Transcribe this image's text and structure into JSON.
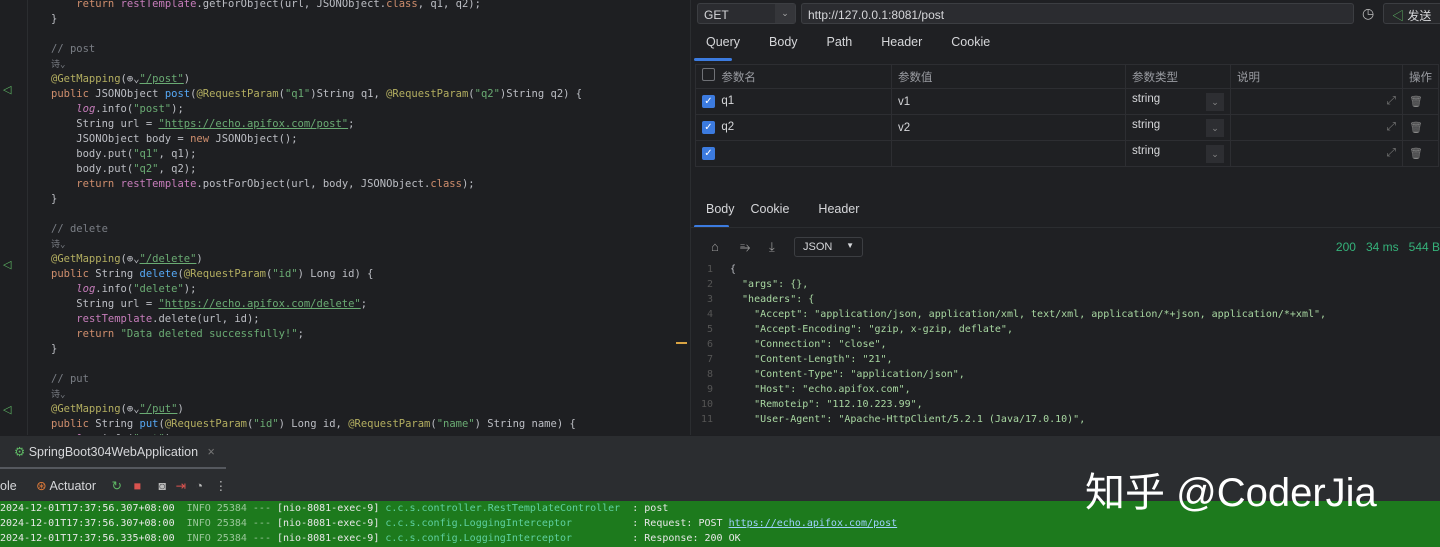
{
  "editor": {
    "lines": [
      [
        [
          "    ",
          ""
        ],
        [
          "return ",
          "kw"
        ],
        [
          "restTemplate",
          "fld"
        ],
        [
          ".getForObject(url, JSONObject.",
          ""
        ],
        [
          "class",
          "kw"
        ],
        [
          ", q1, q2);",
          ""
        ]
      ],
      [
        [
          "}",
          ""
        ]
      ],
      [],
      [
        [
          "// post",
          "cm"
        ]
      ],
      [
        [
          "诗⌄",
          "hint"
        ]
      ],
      [
        [
          "@GetMapping",
          "ann"
        ],
        [
          "(⊕⌄",
          ""
        ],
        [
          "\"/post\"",
          "url"
        ],
        [
          ")",
          ""
        ]
      ],
      [
        [
          "public ",
          "kw"
        ],
        [
          "JSONObject ",
          ""
        ],
        [
          "post",
          "fn"
        ],
        [
          "(",
          ""
        ],
        [
          "@RequestParam",
          "ann"
        ],
        [
          "(",
          ""
        ],
        [
          "\"q1\"",
          "str"
        ],
        [
          ")String q1, ",
          ""
        ],
        [
          "@RequestParam",
          "ann"
        ],
        [
          "(",
          ""
        ],
        [
          "\"q2\"",
          "str"
        ],
        [
          ")String q2) {",
          ""
        ]
      ],
      [
        [
          "    ",
          ""
        ],
        [
          "log",
          "it"
        ],
        [
          ".info(",
          ""
        ],
        [
          "\"post\"",
          "str"
        ],
        [
          ");",
          ""
        ]
      ],
      [
        [
          "    String url = ",
          ""
        ],
        [
          "\"https://echo.apifox.com/post\"",
          "url"
        ],
        [
          ";",
          ""
        ]
      ],
      [
        [
          "    JSONObject body = ",
          ""
        ],
        [
          "new ",
          "kw"
        ],
        [
          "JSONObject();",
          ""
        ]
      ],
      [
        [
          "    body.put(",
          ""
        ],
        [
          "\"q1\"",
          "str"
        ],
        [
          ", q1);",
          ""
        ]
      ],
      [
        [
          "    body.put(",
          ""
        ],
        [
          "\"q2\"",
          "str"
        ],
        [
          ", q2);",
          ""
        ]
      ],
      [
        [
          "    ",
          ""
        ],
        [
          "return ",
          "kw"
        ],
        [
          "restTemplate",
          "fld"
        ],
        [
          ".postForObject(url, body, JSONObject.",
          ""
        ],
        [
          "class",
          "kw"
        ],
        [
          ");",
          ""
        ]
      ],
      [
        [
          "}",
          ""
        ]
      ],
      [],
      [
        [
          "// delete",
          "cm"
        ]
      ],
      [
        [
          "诗⌄",
          "hint"
        ]
      ],
      [
        [
          "@GetMapping",
          "ann"
        ],
        [
          "(⊕⌄",
          ""
        ],
        [
          "\"/delete\"",
          "url"
        ],
        [
          ")",
          ""
        ]
      ],
      [
        [
          "public ",
          "kw"
        ],
        [
          "String ",
          ""
        ],
        [
          "delete",
          "fn"
        ],
        [
          "(",
          ""
        ],
        [
          "@RequestParam",
          "ann"
        ],
        [
          "(",
          ""
        ],
        [
          "\"id\"",
          "str"
        ],
        [
          ") Long id) {",
          ""
        ]
      ],
      [
        [
          "    ",
          ""
        ],
        [
          "log",
          "it"
        ],
        [
          ".info(",
          ""
        ],
        [
          "\"delete\"",
          "str"
        ],
        [
          ");",
          ""
        ]
      ],
      [
        [
          "    String url = ",
          ""
        ],
        [
          "\"https://echo.apifox.com/delete\"",
          "url"
        ],
        [
          ";",
          ""
        ]
      ],
      [
        [
          "    ",
          ""
        ],
        [
          "restTemplate",
          "fld"
        ],
        [
          ".delete(url, id);",
          ""
        ]
      ],
      [
        [
          "    ",
          ""
        ],
        [
          "return ",
          "kw"
        ],
        [
          "\"Data deleted successfully!\"",
          "str"
        ],
        [
          ";",
          ""
        ]
      ],
      [
        [
          "}",
          ""
        ]
      ],
      [],
      [
        [
          "// put",
          "cm"
        ]
      ],
      [
        [
          "诗⌄",
          "hint"
        ]
      ],
      [
        [
          "@GetMapping",
          "ann"
        ],
        [
          "(⊕⌄",
          ""
        ],
        [
          "\"/put\"",
          "url"
        ],
        [
          ")",
          ""
        ]
      ],
      [
        [
          "public ",
          "kw"
        ],
        [
          "String ",
          ""
        ],
        [
          "put",
          "fn"
        ],
        [
          "(",
          ""
        ],
        [
          "@RequestParam",
          "ann"
        ],
        [
          "(",
          ""
        ],
        [
          "\"id\"",
          "str"
        ],
        [
          ") Long id, ",
          ""
        ],
        [
          "@RequestParam",
          "ann"
        ],
        [
          "(",
          ""
        ],
        [
          "\"name\"",
          "str"
        ],
        [
          ") String name) {",
          ""
        ]
      ],
      [
        [
          "    ",
          ""
        ],
        [
          "log",
          "it"
        ],
        [
          ".info(",
          ""
        ],
        [
          "\"put\"",
          "str"
        ],
        [
          ");",
          ""
        ]
      ]
    ]
  },
  "request": {
    "method": "GET",
    "url": "http://127.0.0.1:8081/post",
    "send_label": "发送",
    "tabs": [
      "Query",
      "Body",
      "Path",
      "Header",
      "Cookie"
    ],
    "headers": [
      "参数名",
      "参数值",
      "参数类型",
      "说明",
      "操作"
    ],
    "params": [
      {
        "name": "q1",
        "value": "v1",
        "type": "string",
        "checked": true
      },
      {
        "name": "q2",
        "value": "v2",
        "type": "string",
        "checked": true
      },
      {
        "name": "",
        "value": "",
        "type": "string",
        "checked": true
      }
    ]
  },
  "response": {
    "tabs": [
      "Body",
      "Cookie",
      "Header"
    ],
    "format": "JSON",
    "status": "200",
    "time": "34 ms",
    "size": "544 B",
    "lines": [
      "{",
      "  \"args\": {},",
      "  \"headers\": {",
      "    \"Accept\": \"application/json, application/xml, text/xml, application/*+json, application/*+xml\",",
      "    \"Accept-Encoding\": \"gzip, x-gzip, deflate\",",
      "    \"Connection\": \"close\",",
      "    \"Content-Length\": \"21\",",
      "    \"Content-Type\": \"application/json\",",
      "    \"Host\": \"echo.apifox.com\",",
      "    \"Remoteip\": \"112.10.223.99\",",
      "    \"User-Agent\": \"Apache-HttpClient/5.2.1 (Java/17.0.10)\","
    ]
  },
  "run": {
    "tab": "SpringBoot304WebApplication",
    "console_label": "ole",
    "actuator_label": "Actuator",
    "logs": [
      {
        "time": "2024-12-01T17:37:56.307+08:00",
        "level": "INFO",
        "pid": "25384 ---",
        "thread": "[nio-8081-exec-9]",
        "logger": "c.c.s.controller.RestTemplateController ",
        "msg": ": post",
        "link": ""
      },
      {
        "time": "2024-12-01T17:37:56.307+08:00",
        "level": "INFO",
        "pid": "25384 ---",
        "thread": "[nio-8081-exec-9]",
        "logger": "c.c.s.config.LoggingInterceptor         ",
        "msg": ": Request: POST ",
        "link": "https://echo.apifox.com/post"
      },
      {
        "time": "2024-12-01T17:37:56.335+08:00",
        "level": "INFO",
        "pid": "25384 ---",
        "thread": "[nio-8081-exec-9]",
        "logger": "c.c.s.config.LoggingInterceptor         ",
        "msg": ": Response: 200 OK",
        "link": ""
      }
    ]
  },
  "watermark": "知乎 @CoderJia"
}
